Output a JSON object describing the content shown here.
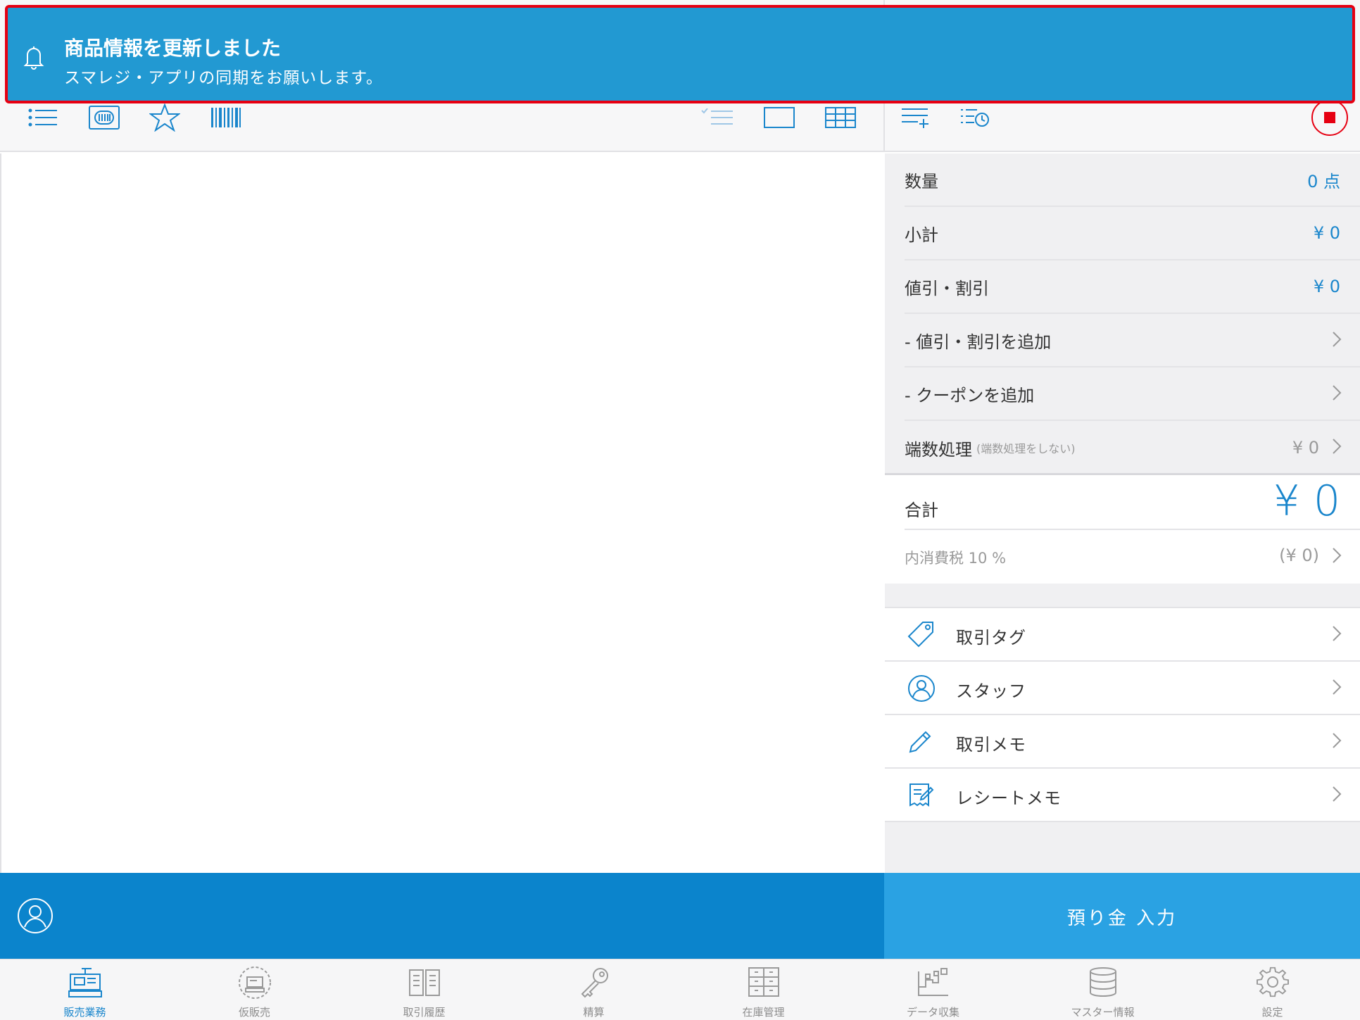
{
  "banner": {
    "title": "商品情報を更新しました",
    "message": "スマレジ・アプリの同期をお願いします。",
    "bg_color": "#2299d2",
    "highlight_color": "#e60012"
  },
  "toolbar": {
    "left_icons": [
      "list-icon",
      "barcode-scan-icon",
      "star-icon",
      "barcode-icon"
    ],
    "right_icons": [
      "checklist-icon",
      "single-view-icon",
      "grid-view-icon"
    ],
    "cart_icons": [
      "add-list-icon",
      "history-list-icon",
      "stop-record-icon"
    ]
  },
  "summary": {
    "quantity": {
      "label": "数量",
      "value": "0 点"
    },
    "subtotal": {
      "label": "小計",
      "value": "¥ 0"
    },
    "discount": {
      "label": "値引・割引",
      "value": "¥ 0"
    },
    "add_discount": {
      "label": "- 値引・割引を追加"
    },
    "add_coupon": {
      "label": "- クーポンを追加"
    },
    "rounding": {
      "label": "端数処理",
      "sub": "(端数処理をしない)",
      "value": "¥ 0"
    },
    "total": {
      "label": "合計",
      "value": "¥ 0"
    },
    "tax": {
      "label": "内消費税 10 %",
      "value": "(¥ 0)"
    }
  },
  "options": [
    {
      "label": "取引タグ",
      "icon": "tag-icon"
    },
    {
      "label": "スタッフ",
      "icon": "staff-icon"
    },
    {
      "label": "取引メモ",
      "icon": "pencil-icon"
    },
    {
      "label": "レシートメモ",
      "icon": "receipt-memo-icon"
    }
  ],
  "action": {
    "deposit_label": "預り金 入力",
    "customer_icon": "customer-icon"
  },
  "tabs": [
    {
      "label": "販売業務",
      "icon": "register-icon",
      "active": true
    },
    {
      "label": "仮販売",
      "icon": "temp-sale-icon",
      "active": false
    },
    {
      "label": "取引履歴",
      "icon": "history-book-icon",
      "active": false
    },
    {
      "label": "精算",
      "icon": "key-icon",
      "active": false
    },
    {
      "label": "在庫管理",
      "icon": "inventory-icon",
      "active": false
    },
    {
      "label": "データ収集",
      "icon": "data-collection-icon",
      "active": false
    },
    {
      "label": "マスター情報",
      "icon": "database-icon",
      "active": false
    },
    {
      "label": "設定",
      "icon": "gear-icon",
      "active": false
    }
  ],
  "colors": {
    "accent": "#1a86cc",
    "action_left": "#0b84cc",
    "action_right": "#2aa2e3"
  }
}
